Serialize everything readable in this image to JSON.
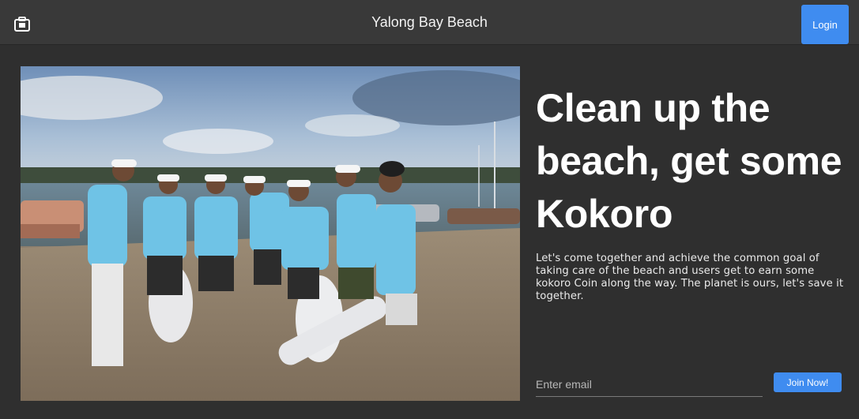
{
  "header": {
    "icon": "suitcase-icon",
    "title": "Yalong Bay Beach",
    "login_label": "Login"
  },
  "hero": {
    "image": "beach-cleanup-volunteers-photo",
    "headline": "Clean up the beach, get some Kokoro",
    "description": "Let's come together and achieve the common goal of taking care of the beach and users get to earn some kokoro Coin along the way. The planet is ours, let's save it together."
  },
  "signup": {
    "email_placeholder": "Enter email",
    "join_label": "Join Now!"
  },
  "colors": {
    "background": "#2f2f2f",
    "topbar": "#393939",
    "accent": "#3f8cf0"
  }
}
